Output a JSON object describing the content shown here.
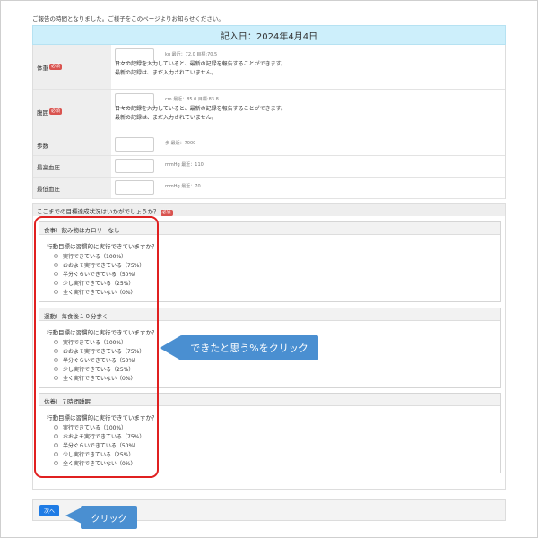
{
  "notice": "ご報告の時間となりました。ご様子をこのページよりお知らせください。",
  "date_header": "記入日：2024年4月4日",
  "required_label": "必須",
  "form": {
    "weight": {
      "label": "体重",
      "hint": "kg 最近：72.0  目標:70.5",
      "msg1": "日々の記録を入力していると、最新の記録を報告することができます。",
      "msg2": "最新の記録は、まだ入力されていません。"
    },
    "waist": {
      "label": "腹囲",
      "hint": "cm 最近：85.0  目標:83.8",
      "msg1": "日々の記録を入力していると、最新の記録を報告することができます。",
      "msg2": "最新の記録は、まだ入力されていません。"
    },
    "steps": {
      "label": "歩数",
      "hint": "歩 最近：7000"
    },
    "bp_high": {
      "label": "最高血圧",
      "hint": "mmHg 最近：110"
    },
    "bp_low": {
      "label": "最低血圧",
      "hint": "mmHg 最近：70"
    }
  },
  "goals": {
    "header": "ここまでの目標達成状況はいかがでしょうか？",
    "question": "行動目標は習慣的に実行できていますか？",
    "options": [
      "実行できている（100%）",
      "おおよそ実行できている（75%）",
      "半分ぐらいできている（50%）",
      "少し実行できている（25%）",
      "全く実行できていない（0%）"
    ],
    "items": [
      {
        "title": "食事）飲み物はカロリーなし"
      },
      {
        "title": "運動）毎食後１０分歩く"
      },
      {
        "title": "休養）７時間睡眠"
      }
    ]
  },
  "callout_percent": "できたと思う%をクリック",
  "next_button": "次へ",
  "callout_click": "クリック",
  "colors": {
    "accent": "#4a8fd1",
    "required": "#d9534f",
    "highlight": "#e02020",
    "button": "#1e7be5",
    "header_bg": "#cdeffb"
  }
}
